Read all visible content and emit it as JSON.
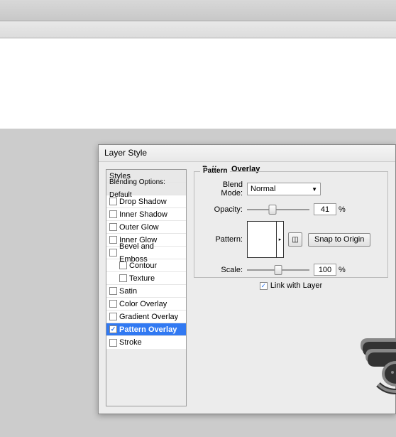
{
  "dialog": {
    "title": "Layer Style",
    "styles_header": "Styles",
    "blending_options": "Blending Options: Default",
    "effects": [
      {
        "key": "drop-shadow",
        "label": "Drop Shadow",
        "checked": false,
        "selected": false
      },
      {
        "key": "inner-shadow",
        "label": "Inner Shadow",
        "checked": false,
        "selected": false
      },
      {
        "key": "outer-glow",
        "label": "Outer Glow",
        "checked": false,
        "selected": false
      },
      {
        "key": "inner-glow",
        "label": "Inner Glow",
        "checked": false,
        "selected": false
      },
      {
        "key": "bevel-emboss",
        "label": "Bevel and Emboss",
        "checked": false,
        "selected": false
      },
      {
        "key": "contour",
        "label": "Contour",
        "checked": false,
        "selected": false,
        "sub": true
      },
      {
        "key": "texture",
        "label": "Texture",
        "checked": false,
        "selected": false,
        "sub": true
      },
      {
        "key": "satin",
        "label": "Satin",
        "checked": false,
        "selected": false
      },
      {
        "key": "color-overlay",
        "label": "Color Overlay",
        "checked": false,
        "selected": false
      },
      {
        "key": "gradient-overlay",
        "label": "Gradient Overlay",
        "checked": false,
        "selected": false
      },
      {
        "key": "pattern-overlay",
        "label": "Pattern Overlay",
        "checked": true,
        "selected": true
      },
      {
        "key": "stroke",
        "label": "Stroke",
        "checked": false,
        "selected": false
      }
    ]
  },
  "panel": {
    "title": "Pattern Overlay",
    "group": "Pattern",
    "blend_mode_label": "Blend Mode:",
    "blend_mode_value": "Normal",
    "opacity_label": "Opacity:",
    "opacity_value": "41",
    "opacity_pct": 41,
    "pattern_label": "Pattern:",
    "snap_label": "Snap to Origin",
    "scale_label": "Scale:",
    "scale_value": "100",
    "scale_pct": 50,
    "link_label": "Link with Layer",
    "link_checked": true,
    "percent": "%"
  }
}
